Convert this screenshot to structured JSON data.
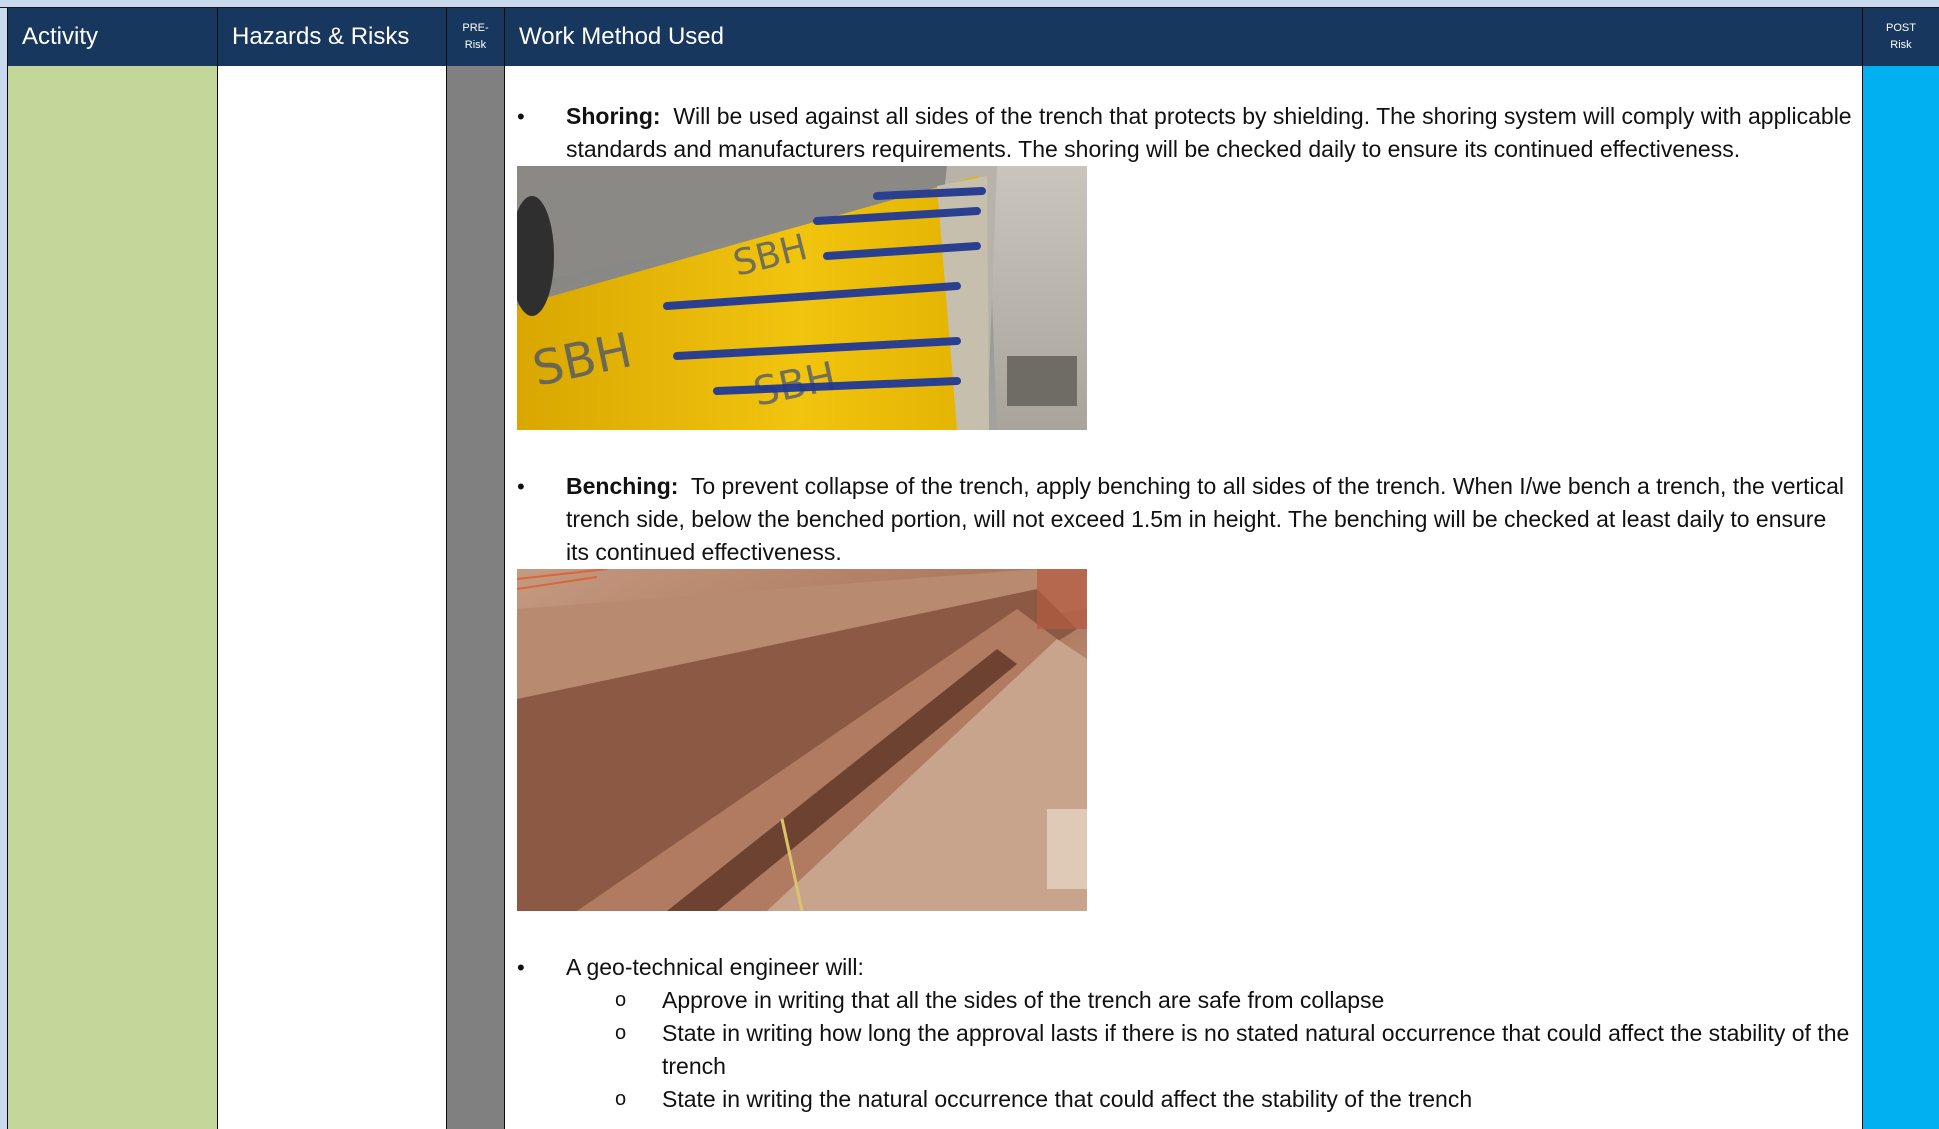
{
  "header": {
    "activity": "Activity",
    "hazards": "Hazards & Risks",
    "pre_line1": "PRE-",
    "pre_line2": "Risk",
    "method": "Work Method Used",
    "post_line1": "POST",
    "post_line2": "Risk"
  },
  "colors": {
    "header_bg": "#17375e",
    "activity_bg": "#c4d79b",
    "pre_risk_bg": "#808080",
    "post_risk_bg": "#00b0f0"
  },
  "method": {
    "shoring": {
      "label": "Shoring:",
      "text": "  Will be used against all sides of the trench that protects by shielding. The shoring system will comply with applicable standards and manufacturers requirements. The shoring will be checked daily to ensure its continued effectiveness."
    },
    "benching": {
      "label": "Benching:",
      "text": "  To prevent collapse of the trench, apply benching to all sides of the trench. When I/we bench a trench, the vertical trench side, below the benched portion, will not exceed 1.5m in height. The benching will be checked at least daily to ensure its continued effectiveness."
    },
    "engineer": {
      "text": "A geo-technical engineer will:",
      "items": [
        "Approve in writing that all the sides of the trench are safe from collapse",
        "State in writing how long the approval lasts if there is no stated natural occurrence that could affect the stability of the trench",
        "State in writing the natural occurrence that could affect the stability of the trench"
      ]
    },
    "bullet_glyph": "•",
    "sub_glyph": "o"
  }
}
